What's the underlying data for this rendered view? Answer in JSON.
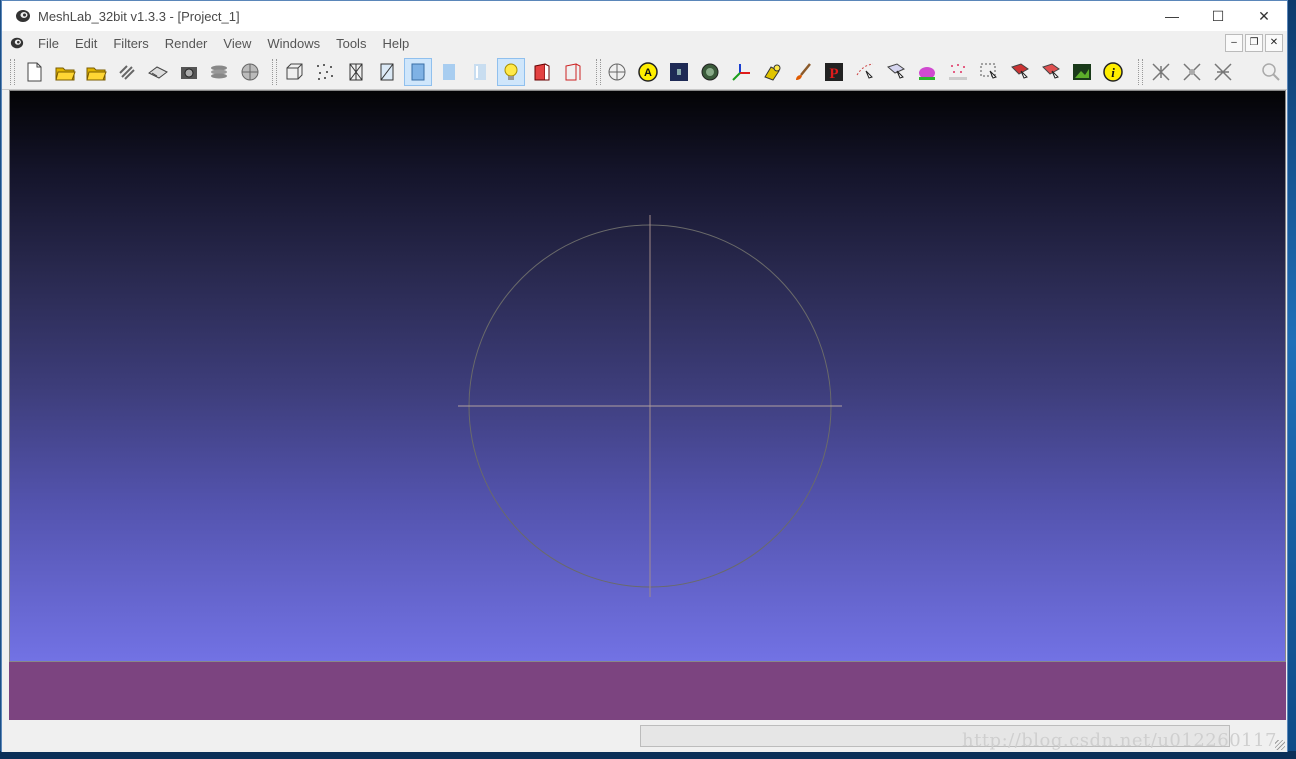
{
  "window": {
    "title": "MeshLab_32bit v1.3.3 - [Project_1]",
    "controls": {
      "minimize": "—",
      "maximize": "☐",
      "close": "✕"
    }
  },
  "menubar": {
    "items": [
      "File",
      "Edit",
      "Filters",
      "Render",
      "View",
      "Windows",
      "Tools",
      "Help"
    ],
    "mdi": {
      "minimize": "‒",
      "restore": "❐",
      "close": "✕"
    }
  },
  "toolbar": {
    "groups": [
      [
        "new-document",
        "open-project",
        "open-folder",
        "reload",
        "save-snapshot",
        "camera",
        "layers",
        "sphere"
      ],
      [
        "bounding-box",
        "points",
        "wireframe",
        "hidden-lines",
        "flat-lines",
        "flat",
        "smooth",
        "lighting",
        "back-face",
        "double-side"
      ],
      [
        "trackball",
        "annotation",
        "render-dark",
        "texture-texel",
        "axes",
        "paint-color",
        "brush",
        "pick-point",
        "select-vertices",
        "select-faces",
        "z-painting",
        "reference",
        "select-rect",
        "select-connected",
        "select-area",
        "raster",
        "info"
      ],
      [
        "align-a",
        "align-b",
        "align-c"
      ],
      [
        "search"
      ]
    ],
    "active": [
      "flat-lines",
      "lighting"
    ]
  },
  "viewport": {
    "gradient_top": "#030305",
    "gradient_bottom": "#7272e4",
    "layer_band_color": "#7c4480"
  },
  "statusbar": {
    "watermark": "http://blog.csdn.net/u012260117"
  }
}
